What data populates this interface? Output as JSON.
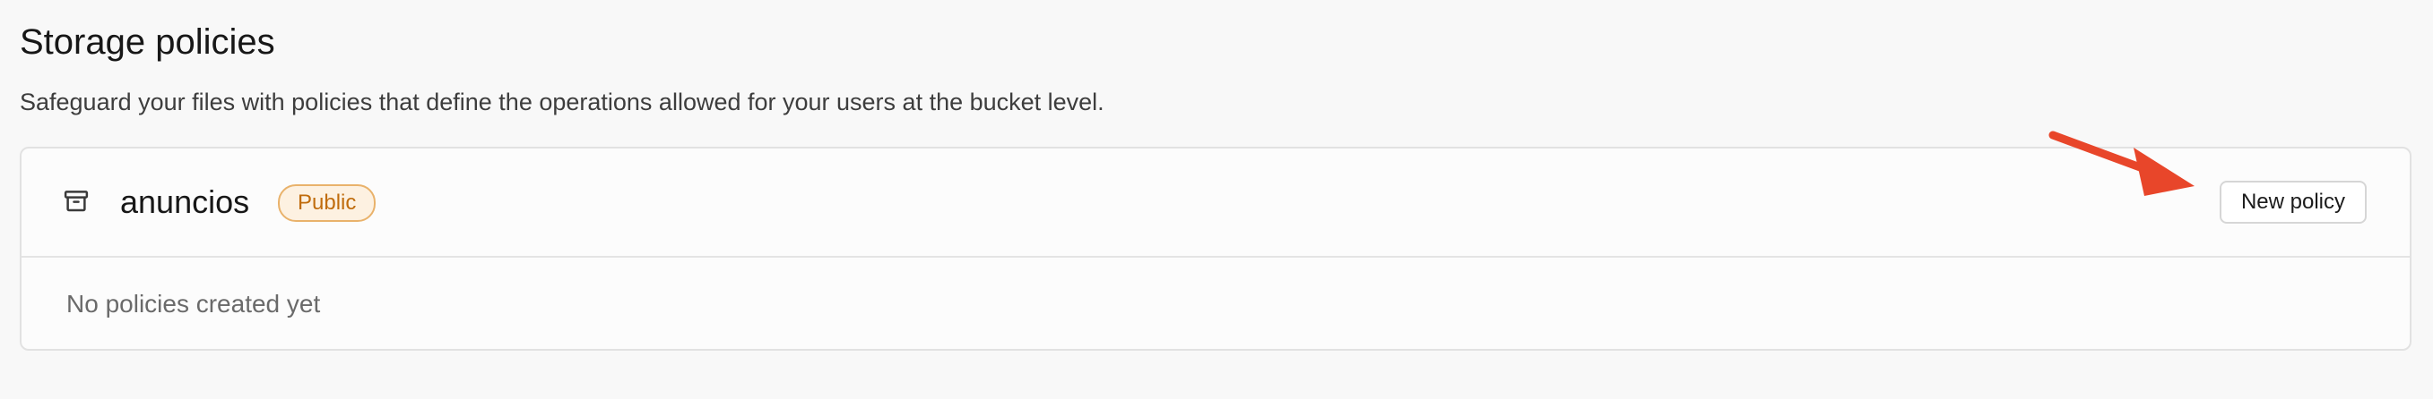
{
  "page": {
    "title": "Storage policies",
    "subtitle": "Safeguard your files with policies that define the operations allowed for your users at the bucket level."
  },
  "bucket": {
    "name": "anuncios",
    "badge": "Public",
    "new_policy_label": "New policy",
    "empty_message": "No policies created yet"
  },
  "colors": {
    "badge_border": "#e9b26b",
    "badge_text": "#c06c0c",
    "annotation_arrow": "#e8462a"
  }
}
